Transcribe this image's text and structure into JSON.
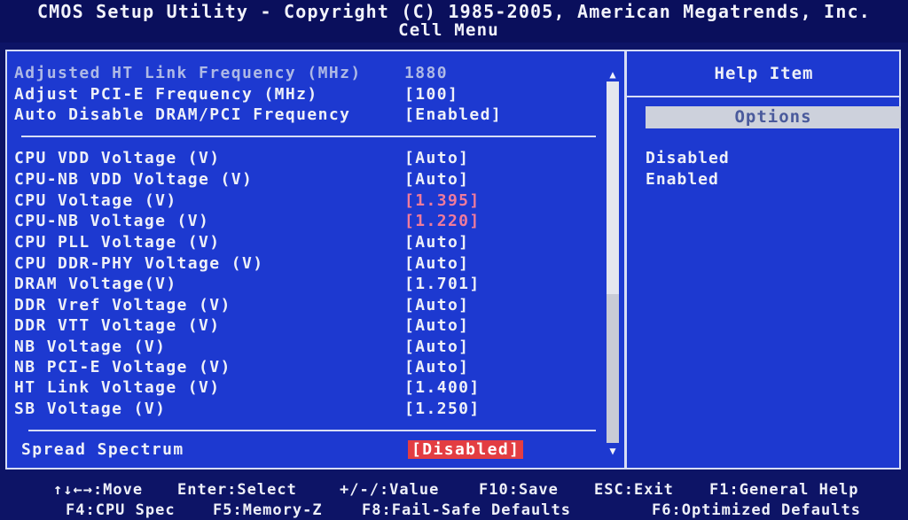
{
  "header": {
    "title": "CMOS Setup Utility - Copyright (C) 1985-2005, American Megatrends, Inc.",
    "menu": "Cell Menu"
  },
  "settings_top": [
    {
      "label": "Adjusted HT Link Frequency (MHz)",
      "value": "1880",
      "dim": true
    },
    {
      "label": "Adjust PCI-E Frequency (MHz)",
      "value": "[100]"
    },
    {
      "label": "Auto Disable DRAM/PCI Frequency",
      "value": "[Enabled]"
    }
  ],
  "settings_voltage": [
    {
      "label": "CPU VDD Voltage (V)",
      "value": "[Auto]"
    },
    {
      "label": "CPU-NB VDD Voltage (V)",
      "value": "[Auto]"
    },
    {
      "label": "CPU Voltage (V)",
      "value": "[1.395]",
      "status": "warning"
    },
    {
      "label": "CPU-NB Voltage (V)",
      "value": "[1.220]",
      "status": "warning"
    },
    {
      "label": "CPU PLL Voltage (V)",
      "value": "[Auto]"
    },
    {
      "label": "CPU DDR-PHY Voltage (V)",
      "value": "[Auto]"
    },
    {
      "label": "DRAM Voltage(V)",
      "value": "[1.701]"
    },
    {
      "label": "DDR Vref Voltage (V)",
      "value": "[Auto]"
    },
    {
      "label": "DDR VTT Voltage (V)",
      "value": "[Auto]"
    },
    {
      "label": "NB Voltage (V)",
      "value": "[Auto]"
    },
    {
      "label": "NB PCI-E Voltage (V)",
      "value": "[Auto]"
    },
    {
      "label": "HT Link Voltage (V)",
      "value": "[1.400]"
    },
    {
      "label": "SB Voltage (V)",
      "value": "[1.250]"
    }
  ],
  "selected_setting": {
    "label": "Spread Spectrum",
    "value": "[Disabled]"
  },
  "help": {
    "title": "Help Item",
    "options_label": "Options",
    "options": [
      "Disabled",
      "Enabled"
    ]
  },
  "footer": {
    "line1": [
      "↑↓←→:Move",
      "Enter:Select",
      "+/-/:Value",
      "F10:Save",
      "ESC:Exit",
      "F1:General Help"
    ],
    "line2": [
      "F4:CPU Spec",
      "F5:Memory-Z",
      "F8:Fail-Safe Defaults",
      "F6:Optimized Defaults"
    ]
  },
  "colors": {
    "background": "#1d39d0",
    "header": "#0a0f5c",
    "warning_value": "#f07b9c",
    "highlight": "#e33d42",
    "options_bar": "#cdd1dc"
  },
  "icons": [
    "scroll-up-arrow-icon",
    "scroll-down-arrow-icon"
  ]
}
